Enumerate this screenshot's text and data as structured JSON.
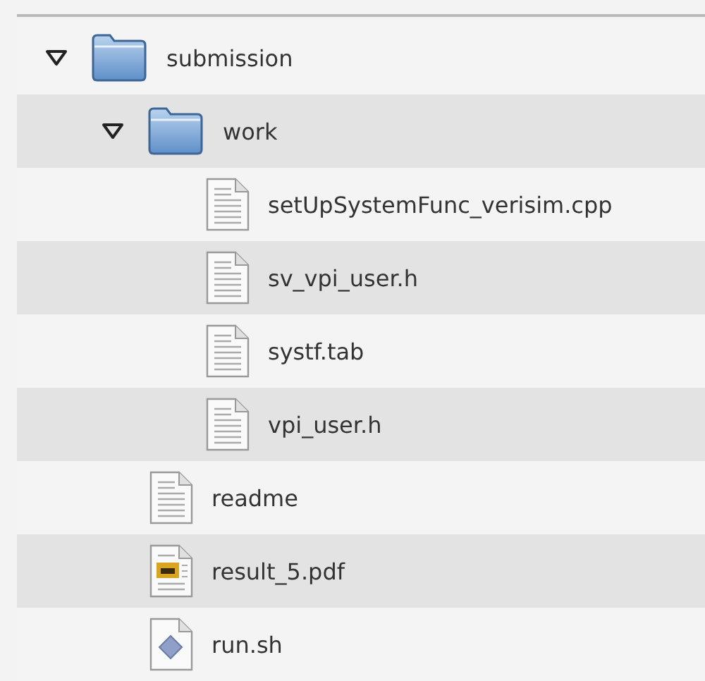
{
  "tree": [
    {
      "name": "submission",
      "kind": "folder",
      "expanded": true,
      "children": [
        {
          "name": "work",
          "kind": "folder",
          "expanded": true,
          "children": [
            {
              "name": "setUpSystemFunc_verisim.cpp",
              "kind": "text"
            },
            {
              "name": "sv_vpi_user.h",
              "kind": "text"
            },
            {
              "name": "systf.tab",
              "kind": "text"
            },
            {
              "name": "vpi_user.h",
              "kind": "text"
            }
          ]
        },
        {
          "name": "readme",
          "kind": "text"
        },
        {
          "name": "result_5.pdf",
          "kind": "pdf"
        },
        {
          "name": "run.sh",
          "kind": "script"
        }
      ]
    }
  ]
}
